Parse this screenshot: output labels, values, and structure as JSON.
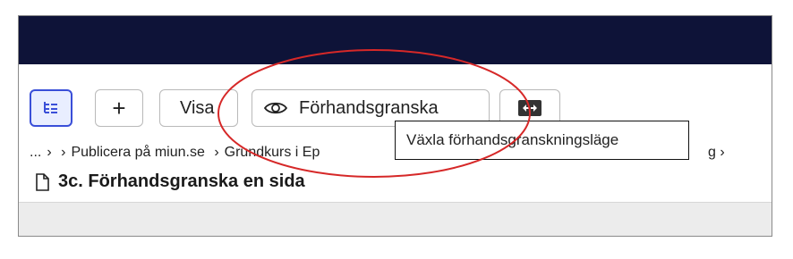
{
  "toolbar": {
    "tree_button": {
      "icon": "tree-view-icon"
    },
    "add_button": {
      "icon": "plus-icon",
      "label": "+"
    },
    "visa_label": "Visa",
    "preview_label": "Förhandsgranska",
    "preview_icon": "eye-icon",
    "toggle_icon": "split-arrows-icon"
  },
  "breadcrumb": {
    "items": [
      "...",
      "Publicera på miun.se",
      "Grundkurs i Ep"
    ],
    "trailing": "g"
  },
  "page": {
    "title": "3c. Förhandsgranska en sida"
  },
  "tooltip": {
    "text": "Växla förhandsgranskningsläge"
  },
  "colors": {
    "topbar": "#0e1338",
    "accent": "#3a4fd8",
    "annotation": "#d62828"
  }
}
